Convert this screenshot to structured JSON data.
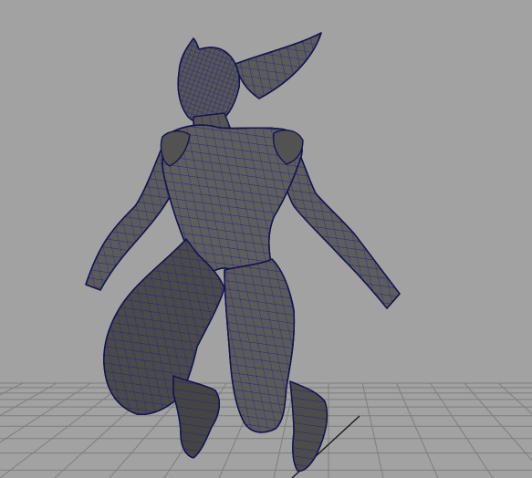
{
  "viewport": {
    "background": "#a2a2a2",
    "grid_color": "#7e7e7e",
    "axis_color": "#1a1a1a",
    "mesh_fill": "#5b5b5b",
    "mesh_fill_dark": "#3e3e3e",
    "wire_color": "#1e1e8c",
    "outline_color": "#14144f"
  },
  "scene": {
    "object": "character-mesh",
    "display_mode": "shaded-wireframe",
    "grid_visible": true
  }
}
